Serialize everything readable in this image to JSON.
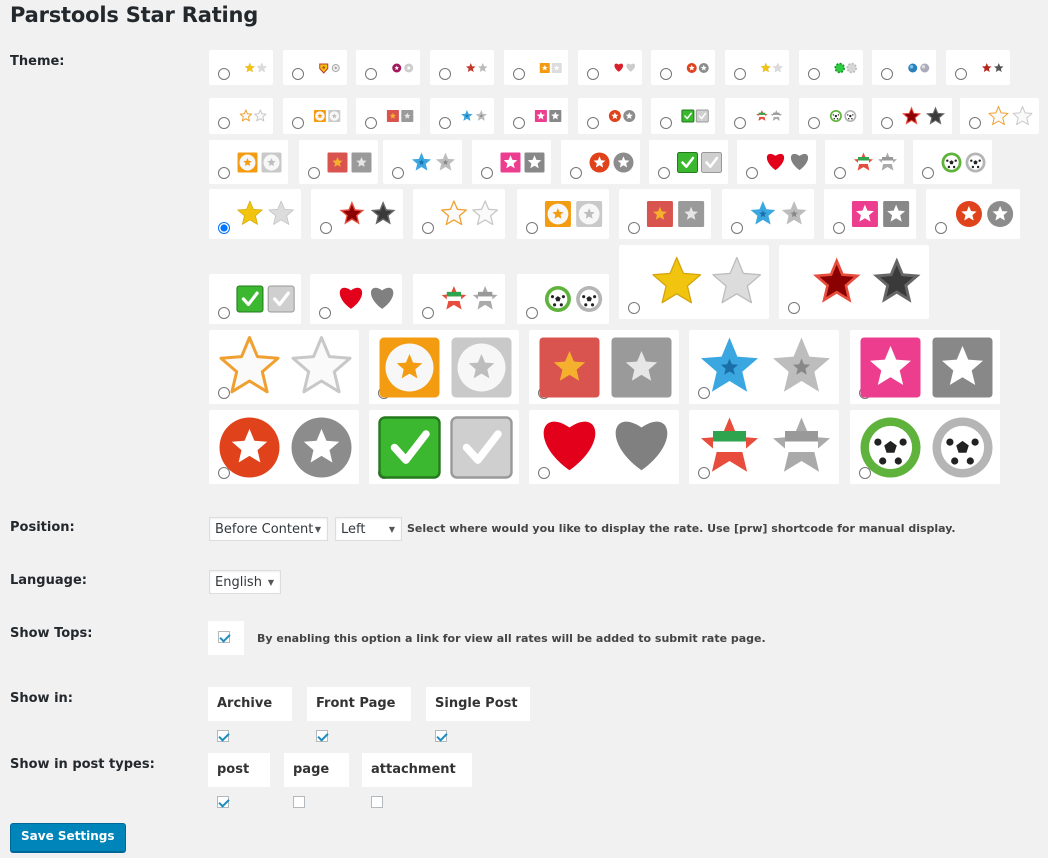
{
  "title": "Parstools Star Rating",
  "labels": {
    "theme": "Theme:",
    "position": "Position:",
    "language": "Language:",
    "show_tops": "Show Tops:",
    "show_in": "Show in:",
    "show_in_post_types": "Show in post types:"
  },
  "theme": {
    "selected": "stars-yellow-32",
    "options": [
      {
        "kind": "stars-yellow",
        "size": "tiny"
      },
      {
        "kind": "badge",
        "size": "tiny"
      },
      {
        "kind": "flower",
        "size": "tiny"
      },
      {
        "kind": "stars-red",
        "size": "tiny"
      },
      {
        "kind": "square-orange",
        "size": "tiny"
      },
      {
        "kind": "heart-wing",
        "size": "tiny"
      },
      {
        "kind": "circle-red",
        "size": "tiny"
      },
      {
        "kind": "stars-yellow",
        "size": "tiny"
      },
      {
        "kind": "gear-green",
        "size": "tiny"
      },
      {
        "kind": "globe",
        "size": "tiny"
      },
      {
        "kind": "stars-dark",
        "size": "tiny"
      },
      {
        "kind": "outline",
        "size": "small"
      },
      {
        "kind": "circle-orange",
        "size": "small"
      },
      {
        "kind": "square-red",
        "size": "small"
      },
      {
        "kind": "blue",
        "size": "small"
      },
      {
        "kind": "pink",
        "size": "small"
      },
      {
        "kind": "circle-red",
        "size": "small"
      },
      {
        "kind": "check",
        "size": "small"
      },
      {
        "kind": "iran",
        "size": "small"
      },
      {
        "kind": "ball",
        "size": "small"
      },
      {
        "kind": "dark-red",
        "size": "small"
      },
      {
        "kind": "outline",
        "size": "small"
      },
      {
        "kind": "circle-orange",
        "size": "medium"
      },
      {
        "kind": "square-red",
        "size": "medium"
      },
      {
        "kind": "blue",
        "size": "medium"
      },
      {
        "kind": "pink",
        "size": "medium"
      },
      {
        "kind": "circle-red",
        "size": "medium"
      },
      {
        "kind": "check",
        "size": "medium"
      },
      {
        "kind": "heart",
        "size": "medium"
      },
      {
        "kind": "iran",
        "size": "medium"
      },
      {
        "kind": "ball",
        "size": "medium"
      },
      {
        "kind": "stars-yellow",
        "size": "large"
      },
      {
        "kind": "dark-red",
        "size": "large"
      },
      {
        "kind": "outline",
        "size": "large"
      },
      {
        "kind": "circle-orange",
        "size": "large"
      },
      {
        "kind": "square-red",
        "size": "large"
      },
      {
        "kind": "blue",
        "size": "large"
      },
      {
        "kind": "pink",
        "size": "large"
      },
      {
        "kind": "circle-red",
        "size": "large"
      },
      {
        "kind": "check",
        "size": "large"
      },
      {
        "kind": "heart",
        "size": "large"
      },
      {
        "kind": "iran",
        "size": "large"
      },
      {
        "kind": "ball",
        "size": "large"
      },
      {
        "kind": "stars-yellow",
        "size": "xl"
      },
      {
        "kind": "dark-red",
        "size": "xl"
      },
      {
        "kind": "outline",
        "size": "xxl"
      },
      {
        "kind": "circle-orange",
        "size": "xxl"
      },
      {
        "kind": "square-red",
        "size": "xxl"
      },
      {
        "kind": "blue",
        "size": "xxl"
      },
      {
        "kind": "pink",
        "size": "xxl"
      },
      {
        "kind": "circle-red",
        "size": "xxl"
      },
      {
        "kind": "check",
        "size": "xxl"
      },
      {
        "kind": "heart",
        "size": "xxl"
      },
      {
        "kind": "iran",
        "size": "xxl"
      },
      {
        "kind": "ball",
        "size": "xxl"
      }
    ]
  },
  "position": {
    "placement": "Before Content",
    "align": "Left",
    "hint": "Select where would you like to display the rate. Use [prw] shortcode for manual display."
  },
  "language": {
    "value": "English"
  },
  "show_tops": {
    "checked": true,
    "text": "By enabling this option a link for view all rates will be added to submit rate page."
  },
  "show_in": [
    {
      "label": "Archive",
      "checked": true
    },
    {
      "label": "Front Page",
      "checked": true
    },
    {
      "label": "Single Post",
      "checked": true
    }
  ],
  "post_types": [
    {
      "label": "post",
      "checked": true
    },
    {
      "label": "page",
      "checked": false
    },
    {
      "label": "attachment",
      "checked": false
    }
  ],
  "save_button": "Save Settings",
  "colors": {
    "primary_button": "#0085ba",
    "check": "#1e8cbe",
    "background": "#f1f1f1"
  }
}
